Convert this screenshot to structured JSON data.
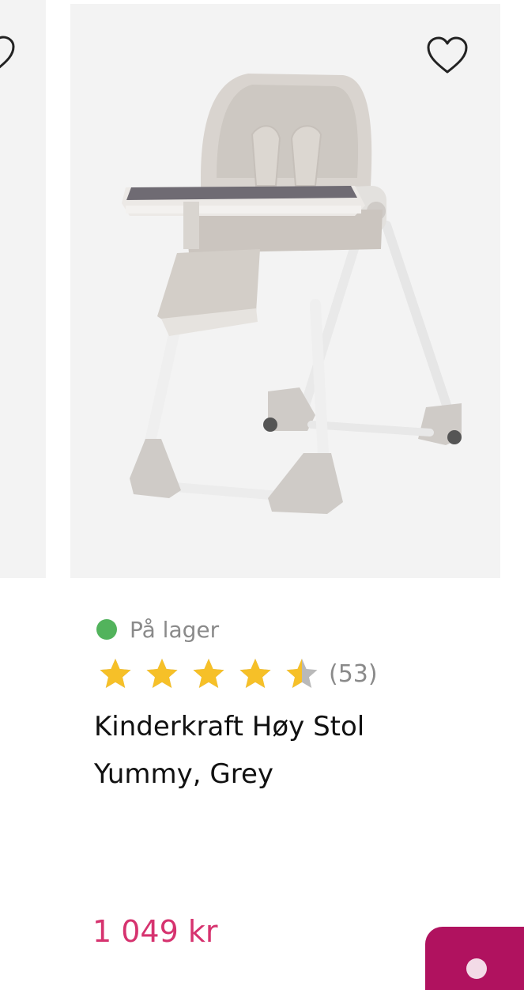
{
  "product": {
    "stock_status": "På lager",
    "rating": 4.5,
    "review_count": "(53)",
    "title_line1": "Kinderkraft Høy Stol",
    "title_line2": "Yummy, Grey",
    "price": "1 049 kr"
  },
  "icons": {
    "favorite": "heart-outline-icon",
    "rating": "star-icon",
    "cart": "cart-icon"
  },
  "colors": {
    "in_stock": "#52b35c",
    "star_filled": "#f6c028",
    "star_empty": "#b9b9b9",
    "price": "#d6336f",
    "cart_button": "#b0125f"
  }
}
